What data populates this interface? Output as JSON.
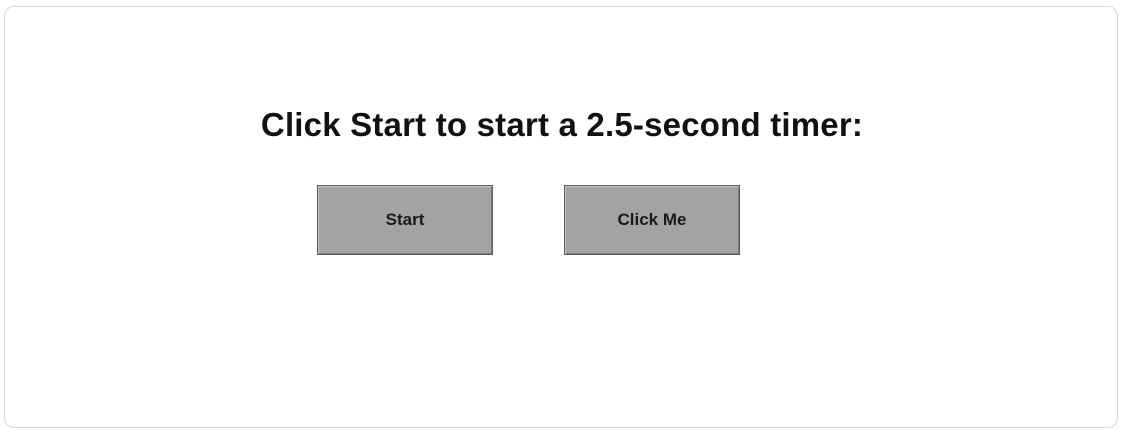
{
  "prompt": {
    "text": "Click Start to start a 2.5-second timer:"
  },
  "buttons": {
    "start_label": "Start",
    "click_me_label": "Click Me"
  },
  "colors": {
    "button_face": "#a3a3a3",
    "button_border": "#5a5a5a",
    "text": "#111111",
    "background": "#ffffff"
  }
}
